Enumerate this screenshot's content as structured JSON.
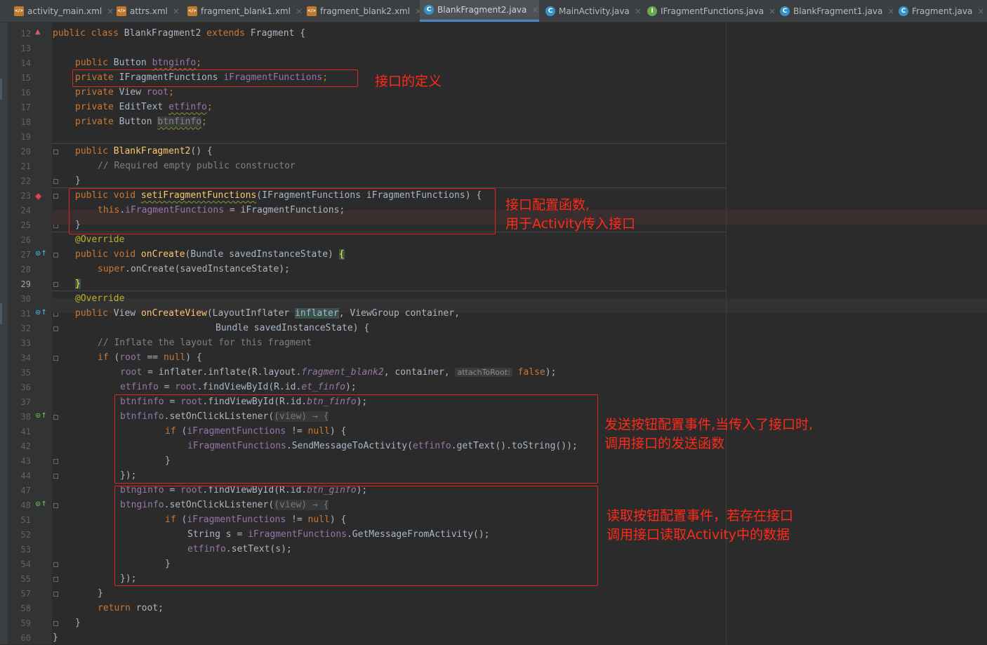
{
  "tabs": [
    {
      "label": "activity_main.xml",
      "icon": "xml-file-icon",
      "active": false
    },
    {
      "label": "attrs.xml",
      "icon": "xml-file-icon",
      "active": false
    },
    {
      "label": "fragment_blank1.xml",
      "icon": "xml-file-icon",
      "active": false
    },
    {
      "label": "fragment_blank2.xml",
      "icon": "xml-file-icon",
      "active": false
    },
    {
      "label": "BlankFragment2.java",
      "icon": "java-class-icon",
      "active": true
    },
    {
      "label": "MainActivity.java",
      "icon": "java-class-icon",
      "active": false
    },
    {
      "label": "IFragmentFunctions.java",
      "icon": "java-interface-icon",
      "active": false
    },
    {
      "label": "BlankFragment1.java",
      "icon": "java-class-icon",
      "active": false
    },
    {
      "label": "Fragment.java",
      "icon": "java-class-icon",
      "active": false
    }
  ],
  "tab_close_glyph": "×",
  "icon_letters": {
    "class": "C",
    "interface": "I",
    "xml": "</>"
  },
  "line_numbers": [
    "12",
    "13",
    "14",
    "15",
    "16",
    "17",
    "18",
    "19",
    "20",
    "21",
    "22",
    "23",
    "24",
    "25",
    "26",
    "27",
    "28",
    "29",
    "30",
    "31",
    "32",
    "33",
    "34",
    "35",
    "36",
    "37",
    "38",
    "41",
    "42",
    "43",
    "44",
    "47",
    "48",
    "51",
    "52",
    "53",
    "54",
    "55",
    "57",
    "58",
    "59",
    "60"
  ],
  "current_line": "29",
  "code": {
    "l12": {
      "public": "public ",
      "class": "class ",
      "name": "BlankFragment2 ",
      "extends": "extends ",
      "base": "Fragment {"
    },
    "l14": {
      "mods": "public ",
      "type": "Button ",
      "field": "btnginfo",
      "end": ";"
    },
    "l15": {
      "mods": "private ",
      "type": "IFragmentFunctions ",
      "field": "iFragmentFunctions",
      "end": ";"
    },
    "l16": {
      "mods": "private ",
      "type": "View ",
      "field": "root",
      "end": ";"
    },
    "l17": {
      "mods": "private ",
      "type": "EditText ",
      "field": "etfinfo",
      "end": ";"
    },
    "l18": {
      "mods": "private ",
      "type": "Button ",
      "field": "btnfinfo",
      "end": ";"
    },
    "l20": {
      "mods": "public ",
      "name": "BlankFragment2",
      "rest": "() {"
    },
    "l21": "// Required empty public constructor",
    "l22": "}",
    "l23": {
      "mods": "public void ",
      "name": "setiFragmentFunctions",
      "rest": "(IFragmentFunctions iFragmentFunctions) {"
    },
    "l24": {
      "this": "this",
      "dot": ".",
      "field": "iFragmentFunctions",
      "rest": " = iFragmentFunctions;"
    },
    "l25": "}",
    "l26": "@Override",
    "l27": {
      "mods": "public void ",
      "name": "onCreate",
      "rest": "(Bundle savedInstanceState) ",
      "brace": "{"
    },
    "l28": {
      "super": "super",
      "rest": ".onCreate(savedInstanceState);"
    },
    "l29": "}",
    "l30": "@Override",
    "l31": {
      "mods": "public ",
      "type": "View ",
      "name": "onCreateView",
      "p1": "(LayoutInflater ",
      "inflater": "inflater",
      "p2": ", ViewGroup container,"
    },
    "l32": "Bundle savedInstanceState) {",
    "l33": "// Inflate the layout for this fragment",
    "l34": {
      "if": "if ",
      "open": "(",
      "root": "root",
      "eq": " == ",
      "null": "null",
      "close": ") {"
    },
    "l35": {
      "root": "root",
      "a": " = inflater.inflate(R.layout.",
      "layout": "fragment_blank2",
      "b": ", container, ",
      "hint": "attachToRoot:",
      "false": "false",
      "c": ");"
    },
    "l36": {
      "field": "etfinfo",
      "a": " = ",
      "root": "root",
      "b": ".findViewById(R.id.",
      "id": "et_finfo",
      "c": ");"
    },
    "l37": {
      "field": "btnfinfo",
      "a": " = ",
      "root": "root",
      "b": ".findViewById(R.id.",
      "id": "btn_finfo",
      "c": ");"
    },
    "l38": {
      "field": "btnfinfo",
      "a": ".setOnClickListener(",
      "lambda": "(view) → {"
    },
    "l41": {
      "if": "if ",
      "open": "(",
      "field": "iFragmentFunctions",
      "ne": " != ",
      "null": "null",
      "close": ") {"
    },
    "l42": {
      "field": "iFragmentFunctions",
      "a": ".SendMessageToActivity(",
      "et": "etfinfo",
      "b": ".getText().toString());"
    },
    "l43": "}",
    "l44": "});",
    "l47": {
      "field": "btnginfo",
      "a": " = ",
      "root": "root",
      "b": ".findViewById(R.id.",
      "id": "btn_ginfo",
      "c": ");"
    },
    "l48": {
      "field": "btnginfo",
      "a": ".setOnClickListener(",
      "lambda": "(view) → {"
    },
    "l51": {
      "if": "if ",
      "open": "(",
      "field": "iFragmentFunctions",
      "ne": " != ",
      "null": "null",
      "close": ") {"
    },
    "l52": {
      "a": "String s = ",
      "field": "iFragmentFunctions",
      "b": ".GetMessageFromActivity();"
    },
    "l53": {
      "field": "etfinfo",
      "a": ".setText(s);"
    },
    "l54": "}",
    "l55": "});",
    "l57": "}",
    "l58": {
      "return": "return ",
      "rest": "root;"
    },
    "l59": "}",
    "l60": "}"
  },
  "notes": {
    "interface_def": "接口的定义",
    "setter_1": "接口配置函数,",
    "setter_2": "用于Activity传入接口",
    "send_1": "发送按钮配置事件,当传入了接口时,",
    "send_2": "调用接口的发送函数",
    "read_1": "读取按钮配置事件，若存在接口",
    "read_2": "调用接口读取Activity中的数据"
  },
  "colors": {
    "annotation_red": "#e0261f",
    "editor_bg": "#2b2b2b",
    "keyword": "#cc7832",
    "field": "#9876aa",
    "method": "#ffc66d"
  }
}
